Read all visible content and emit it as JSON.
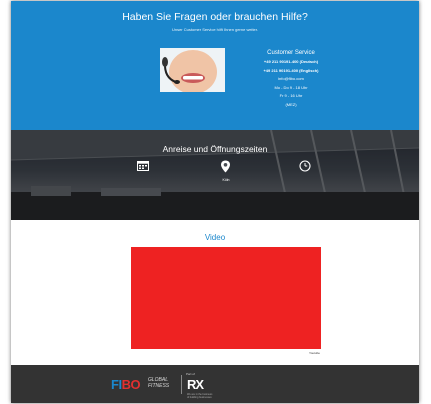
{
  "help": {
    "title": "Haben Sie Fragen oder brauchen Hilfe?",
    "subtitle": "Unser Customer Service hilft Ihnen gerne weiter.",
    "service": {
      "title": "Customer Service",
      "phone_de": "+49 211 90191-400 (Deutsch)",
      "phone_en": "+49 211 90191-400 (Englisch)",
      "email": "info@fibo.com",
      "line_4": "Mo - Do 9 - 18 Uhr",
      "line_5": "Fr 9 - 16 Uhr",
      "line_6": "(MEZ)"
    }
  },
  "arrival": {
    "title": "Anreise und Öffnungszeiten",
    "location_label": "Köln",
    "icons": [
      "calendar-icon",
      "location-pin-icon",
      "clock-icon"
    ]
  },
  "video": {
    "title": "Video",
    "note": "Youtube"
  },
  "footer": {
    "fibo_fi": "FI",
    "fibo_bo": "BO",
    "global_line1": "GLOBAL",
    "global_line2": "FITNESS",
    "rx_small": "Part of",
    "rx": "RX",
    "rx_tag_line1": "We are in the business",
    "rx_tag_line2": "of building businesses"
  },
  "colors": {
    "brand_blue": "#1b87cc",
    "video_red": "#ee2222",
    "footer_dark": "#333333"
  }
}
